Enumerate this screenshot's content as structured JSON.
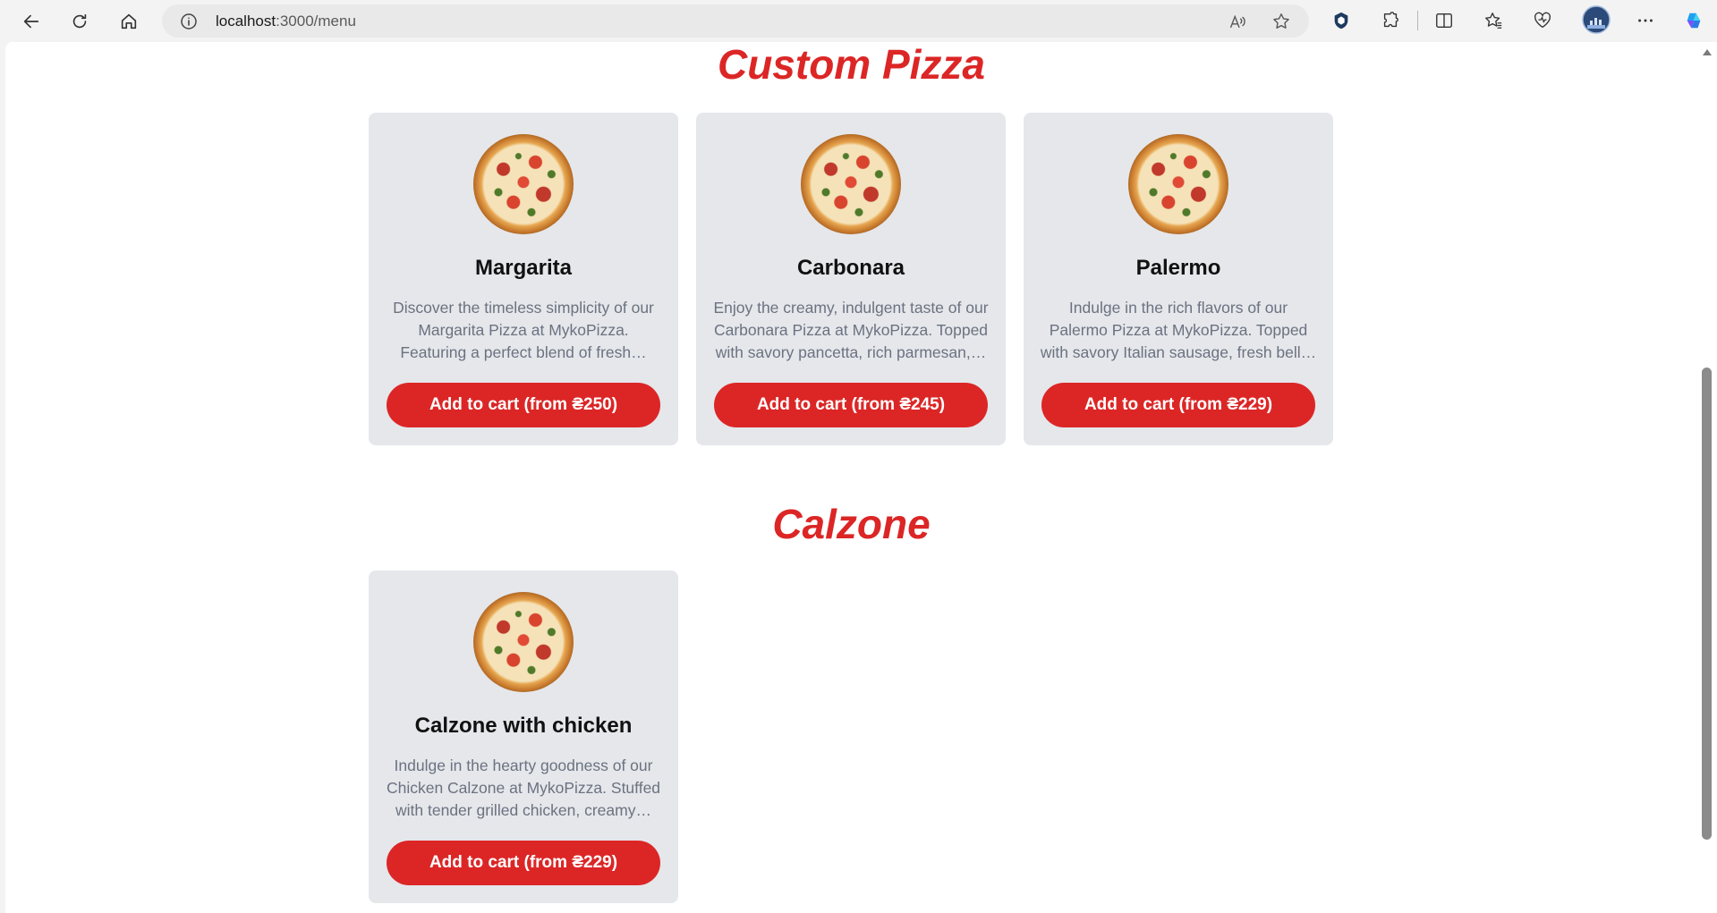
{
  "browser": {
    "url_host": "localhost",
    "url_path": ":3000/menu"
  },
  "icons": {
    "back": "back-arrow-icon",
    "reload": "reload-icon",
    "home": "home-icon",
    "info": "info-icon",
    "read_aloud": "read-aloud-icon",
    "favorite": "star-icon",
    "extensions": "puzzle-icon",
    "split": "split-screen-icon",
    "favorites": "favorites-icon",
    "health": "browser-essentials-icon",
    "profile": "profile-avatar",
    "more": "more-icon",
    "copilot": "copilot-icon"
  },
  "colors": {
    "accent": "#dc2626",
    "card_bg": "#e5e7eb",
    "desc_text": "#6b7280"
  },
  "sections": [
    {
      "title": "Custom Pizza",
      "items": [
        {
          "name": "Margarita",
          "description": "Discover the timeless simplicity of our Margarita Pizza at MykoPizza. Featuring a perfect blend of fresh…",
          "button": "Add to cart (from ₴250)"
        },
        {
          "name": "Carbonara",
          "description": "Enjoy the creamy, indulgent taste of our Carbonara Pizza at MykoPizza. Topped with savory pancetta, rich parmesan,…",
          "button": "Add to cart (from ₴245)"
        },
        {
          "name": "Palermo",
          "description": "Indulge in the rich flavors of our Palermo Pizza at MykoPizza. Topped with savory Italian sausage, fresh bell…",
          "button": "Add to cart (from ₴229)"
        }
      ]
    },
    {
      "title": "Calzone",
      "items": [
        {
          "name": "Calzone with chicken",
          "description": "Indulge in the hearty goodness of our Chicken Calzone at MykoPizza. Stuffed with tender grilled chicken, creamy…",
          "button": "Add to cart (from ₴229)"
        }
      ]
    }
  ]
}
